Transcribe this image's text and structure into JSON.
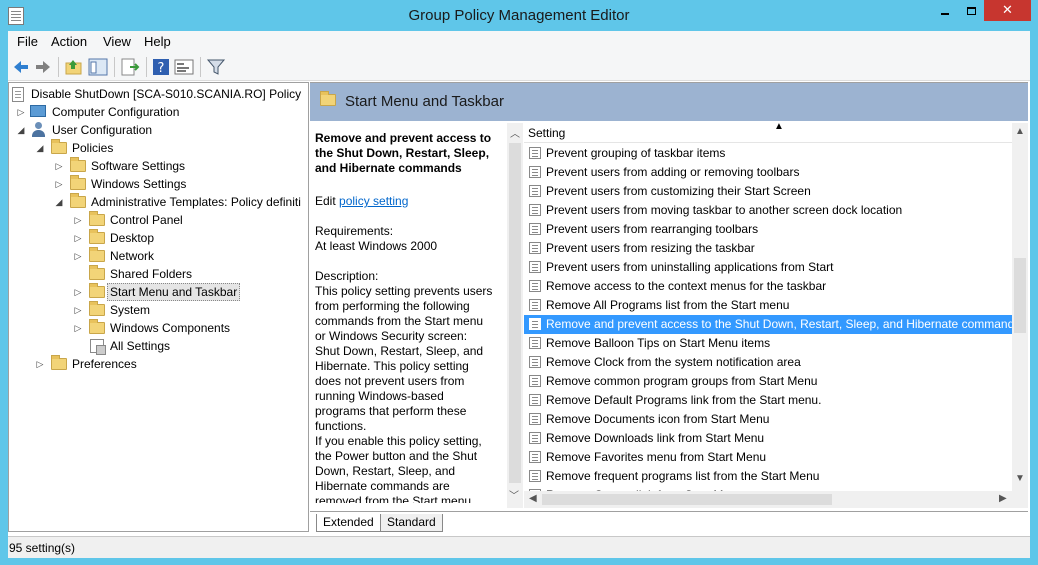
{
  "window": {
    "title": "Group Policy Management Editor",
    "close_glyph": "✕"
  },
  "menu": {
    "file": "File",
    "action": "Action",
    "view": "View",
    "help": "Help"
  },
  "tree": {
    "items": [
      {
        "label": "Disable ShutDown [SCA-S010.SCANIA.RO] Policy"
      },
      {
        "label": "Computer Configuration"
      },
      {
        "label": "User Configuration"
      },
      {
        "label": "Policies"
      },
      {
        "label": "Software Settings"
      },
      {
        "label": "Windows Settings"
      },
      {
        "label": "Administrative Templates: Policy definiti"
      },
      {
        "label": "Control Panel"
      },
      {
        "label": "Desktop"
      },
      {
        "label": "Network"
      },
      {
        "label": "Shared Folders"
      },
      {
        "label": "Start Menu and Taskbar"
      },
      {
        "label": "System"
      },
      {
        "label": "Windows Components"
      },
      {
        "label": "All Settings"
      },
      {
        "label": "Preferences"
      }
    ]
  },
  "header": {
    "title": "Start Menu and Taskbar"
  },
  "description": {
    "title": "Remove and prevent access to the Shut Down, Restart, Sleep, and Hibernate commands",
    "edit_prefix": "Edit",
    "edit_link": "policy setting",
    "requirements_label": "Requirements:",
    "requirements_value": "At least Windows 2000",
    "description_label": "Description:",
    "description_p1": "This policy setting prevents users from performing the following commands from the Start menu or Windows Security screen: Shut Down, Restart, Sleep, and Hibernate. This policy setting does not prevent users from running Windows-based programs that perform these functions.",
    "description_p2": "If you enable this policy setting, the Power button and the Shut Down, Restart, Sleep, and Hibernate commands are removed from the Start menu."
  },
  "settings": {
    "column_header": "Setting",
    "sort_glyph": "▲",
    "rows": [
      "Prevent grouping of taskbar items",
      "Prevent users from adding or removing toolbars",
      "Prevent users from customizing their Start Screen",
      "Prevent users from moving taskbar to another screen dock location",
      "Prevent users from rearranging toolbars",
      "Prevent users from resizing the taskbar",
      "Prevent users from uninstalling applications from Start",
      "Remove access to the context menus for the taskbar",
      "Remove All Programs list from the Start menu",
      "Remove and prevent access to the Shut Down, Restart, Sleep, and Hibernate commands",
      "Remove Balloon Tips on Start Menu items",
      "Remove Clock from the system notification area",
      "Remove common program groups from Start Menu",
      "Remove Default Programs link from the Start menu.",
      "Remove Documents icon from Start Menu",
      "Remove Downloads link from Start Menu",
      "Remove Favorites menu from Start Menu",
      "Remove frequent programs list from the Start Menu",
      "Remove Games link from Start Menu"
    ],
    "selected_index": 9
  },
  "tabs": {
    "extended": "Extended",
    "standard": "Standard"
  },
  "status": {
    "text": "95 setting(s)"
  },
  "colors": {
    "titlebar": "#5fc6e9",
    "close_button": "#c7362f",
    "selection": "#3399ff",
    "header_band": "#9cb3d1"
  }
}
